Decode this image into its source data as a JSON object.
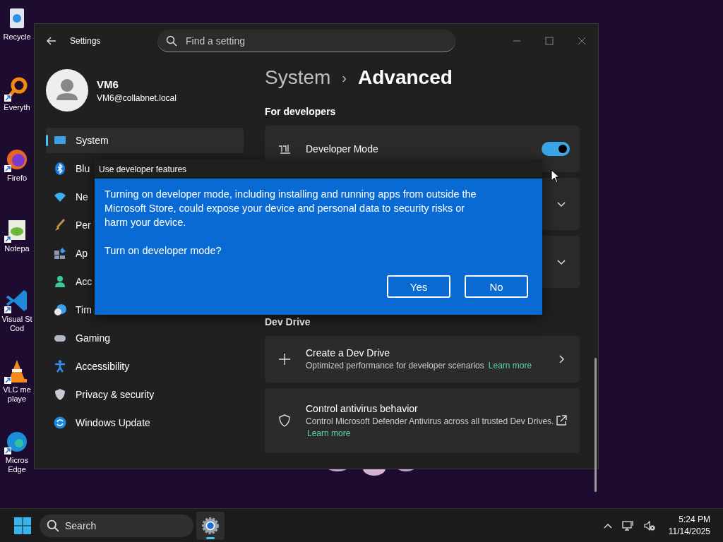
{
  "desktop_icons": [
    {
      "lines": [
        "Recycle"
      ]
    },
    {
      "lines": [
        "Everyth"
      ]
    },
    {
      "lines": [
        "Firefo"
      ]
    },
    {
      "lines": [
        "Notepa"
      ]
    },
    {
      "lines": [
        "Visual St",
        "Cod"
      ]
    },
    {
      "lines": [
        "VLC me",
        "playe"
      ]
    },
    {
      "lines": [
        "Micros",
        "Edge"
      ]
    }
  ],
  "settings_window": {
    "title": "Settings",
    "search": {
      "placeholder": "Find a setting"
    },
    "user": {
      "name": "VM6",
      "email": "VM6@collabnet.local"
    },
    "nav": [
      {
        "label": "System",
        "selected": true
      },
      {
        "label": "Blu",
        "selected": false
      },
      {
        "label": "Ne",
        "selected": false
      },
      {
        "label": "Per",
        "selected": false
      },
      {
        "label": "Ap",
        "selected": false
      },
      {
        "label": "Acc",
        "selected": false
      },
      {
        "label": "Tim",
        "selected": false
      },
      {
        "label": "Gaming",
        "selected": false
      },
      {
        "label": "Accessibility",
        "selected": false
      },
      {
        "label": "Privacy & security",
        "selected": false
      },
      {
        "label": "Windows Update",
        "selected": false
      }
    ],
    "breadcrumb": {
      "parent": "System",
      "separator": "›",
      "current": "Advanced"
    },
    "sections": [
      {
        "heading": "For developers",
        "cards": [
          {
            "kind": "toggle",
            "title": "Developer Mode",
            "on": true
          },
          {
            "kind": "expander"
          },
          {
            "kind": "expander"
          }
        ]
      },
      {
        "heading": "Dev Drive",
        "cards": [
          {
            "kind": "navigate",
            "title": "Create a Dev Drive",
            "description": "Optimized performance for developer scenarios",
            "link": "Learn more"
          },
          {
            "kind": "external",
            "title": "Control antivirus behavior",
            "description": "Control Microsoft Defender Antivirus across all trusted Dev Drives.",
            "link": "Learn more"
          }
        ]
      }
    ]
  },
  "dialog": {
    "title": "Use developer features",
    "paragraphs": [
      "Turning on developer mode, including installing and running apps from outside the Microsoft Store, could expose your device and personal data to security risks or harm your device.",
      "Turn on developer mode?"
    ],
    "buttons": [
      "Yes",
      "No"
    ]
  },
  "taskbar": {
    "search": {
      "placeholder": "Search"
    },
    "apps": [
      {
        "running": true
      }
    ],
    "time": "5:24 PM",
    "date": "11/14/2025"
  }
}
